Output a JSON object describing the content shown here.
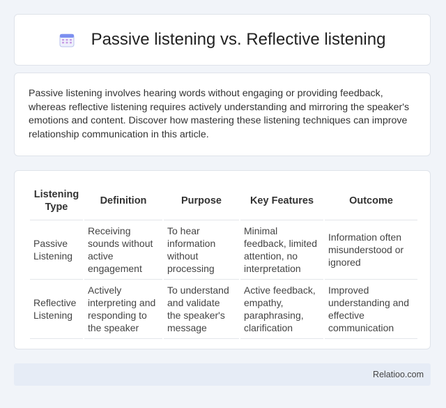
{
  "header": {
    "title": "Passive listening vs. Reflective listening",
    "icon": "calendar-icon"
  },
  "intro": {
    "text": "Passive listening involves hearing words without engaging or providing feedback, whereas reflective listening requires actively understanding and mirroring the speaker's emotions and content. Discover how mastering these listening techniques can improve relationship communication in this article."
  },
  "table": {
    "headers": [
      "Listening Type",
      "Definition",
      "Purpose",
      "Key Features",
      "Outcome"
    ],
    "rows": [
      [
        "Passive Listening",
        "Receiving sounds without active engagement",
        "To hear information without processing",
        "Minimal feedback, limited attention, no interpretation",
        "Information often misunderstood or ignored"
      ],
      [
        "Reflective Listening",
        "Actively interpreting and responding to the speaker",
        "To understand and validate the speaker's message",
        "Active feedback, empathy, paraphrasing, clarification",
        "Improved understanding and effective communication"
      ]
    ]
  },
  "footer": {
    "brand": "Relatioo.com"
  },
  "colors": {
    "background": "#f1f4f9",
    "card": "#ffffff",
    "footer": "#e6ecf6",
    "icon_accent": "#7c8ff0"
  }
}
